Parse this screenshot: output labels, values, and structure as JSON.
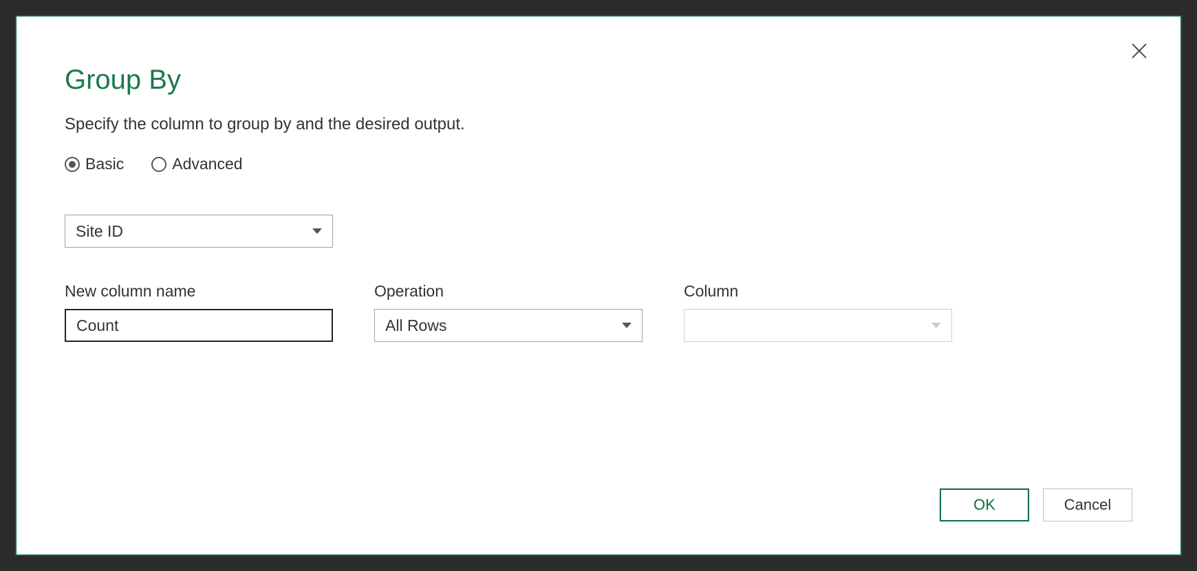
{
  "dialog": {
    "title": "Group By",
    "subtitle": "Specify the column to group by and the desired output.",
    "radios": {
      "basic": "Basic",
      "advanced": "Advanced",
      "selected": "basic"
    },
    "groupByColumn": "Site ID",
    "fields": {
      "newColumnName": {
        "label": "New column name",
        "value": "Count"
      },
      "operation": {
        "label": "Operation",
        "value": "All Rows"
      },
      "column": {
        "label": "Column",
        "value": ""
      }
    },
    "buttons": {
      "ok": "OK",
      "cancel": "Cancel"
    }
  }
}
